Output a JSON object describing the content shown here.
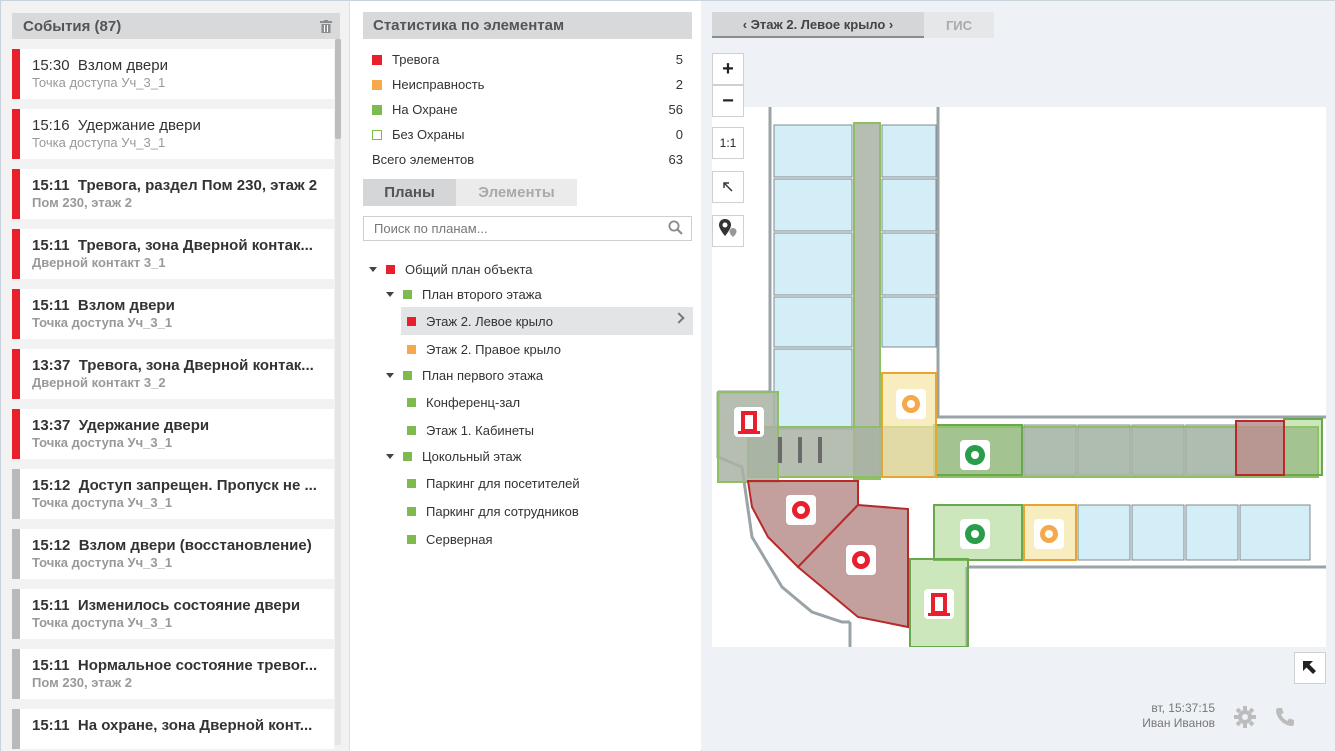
{
  "events_panel": {
    "title": "События (87)",
    "items": [
      {
        "time": "15:30",
        "title": "Взлом двери",
        "sub": "Точка доступа Уч_3_1",
        "kind": "alarm",
        "bold": false
      },
      {
        "time": "15:16",
        "title": "Удержание двери",
        "sub": "Точка доступа Уч_3_1",
        "kind": "alarm",
        "bold": false
      },
      {
        "time": "15:11",
        "title": "Тревога, раздел Пом 230, этаж 2",
        "sub": "Пом 230, этаж 2",
        "kind": "alarm",
        "bold": true
      },
      {
        "time": "15:11",
        "title": "Тревога, зона Дверной контак...",
        "sub": "Дверной контакт 3_1",
        "kind": "alarm",
        "bold": true
      },
      {
        "time": "15:11",
        "title": "Взлом двери",
        "sub": "Точка доступа Уч_3_1",
        "kind": "alarm",
        "bold": true
      },
      {
        "time": "13:37",
        "title": "Тревога, зона Дверной контак...",
        "sub": "Дверной контакт 3_2",
        "kind": "alarm",
        "bold": true
      },
      {
        "time": "13:37",
        "title": "Удержание двери",
        "sub": "Точка доступа Уч_3_1",
        "kind": "alarm",
        "bold": true
      },
      {
        "time": "15:12",
        "title": "Доступ запрещен. Пропуск не ...",
        "sub": "Точка доступа Уч_3_1",
        "kind": "normal",
        "bold": true
      },
      {
        "time": "15:12",
        "title": "Взлом двери (восстановление)",
        "sub": "Точка доступа Уч_3_1",
        "kind": "normal",
        "bold": true
      },
      {
        "time": "15:11",
        "title": "Изменилось состояние двери",
        "sub": "Точка доступа Уч_3_1",
        "kind": "normal",
        "bold": true
      },
      {
        "time": "15:11",
        "title": "Нормальное состояние тревог...",
        "sub": "Пом 230, этаж 2",
        "kind": "normal",
        "bold": true
      },
      {
        "time": "15:11",
        "title": "На охране, зона Дверной конт...",
        "sub": "",
        "kind": "normal",
        "bold": true
      }
    ]
  },
  "stats_panel": {
    "title": "Статистика по элементам",
    "rows": [
      {
        "label": "Тревога",
        "value": "5",
        "color": "#e8202e",
        "outline": false
      },
      {
        "label": "Неисправность",
        "value": "2",
        "color": "#f5a94a",
        "outline": false
      },
      {
        "label": "На Охране",
        "value": "56",
        "color": "#7dbb4f",
        "outline": false
      },
      {
        "label": "Без Охраны",
        "value": "0",
        "color": "#7dbb4f",
        "outline": true
      }
    ],
    "total_label": "Всего элементов",
    "total_value": "63"
  },
  "tabs": {
    "plans": "Планы",
    "elements": "Элементы"
  },
  "search": {
    "placeholder": "Поиск по планам..."
  },
  "tree": [
    {
      "label": "Общий план объекта",
      "level": 0,
      "expander": true,
      "color": "#e8202e",
      "selected": false
    },
    {
      "label": "План второго этажа",
      "level": 1,
      "expander": true,
      "color": "#7dbb4f",
      "selected": false
    },
    {
      "label": "Этаж 2. Левое крыло",
      "level": 2,
      "expander": false,
      "color": "#e8202e",
      "selected": true
    },
    {
      "label": "Этаж 2. Правое крыло",
      "level": 2,
      "expander": false,
      "color": "#f5a94a",
      "selected": false
    },
    {
      "label": "План первого этажа",
      "level": 1,
      "expander": true,
      "color": "#7dbb4f",
      "selected": false
    },
    {
      "label": "Конференц-зал",
      "level": 2,
      "expander": false,
      "color": "#7dbb4f",
      "selected": false
    },
    {
      "label": "Этаж 1. Кабинеты",
      "level": 2,
      "expander": false,
      "color": "#7dbb4f",
      "selected": false
    },
    {
      "label": "Цокольный этаж",
      "level": 1,
      "expander": true,
      "color": "#7dbb4f",
      "selected": false
    },
    {
      "label": "Паркинг для посетителей",
      "level": 2,
      "expander": false,
      "color": "#7dbb4f",
      "selected": false
    },
    {
      "label": "Паркинг для сотрудников",
      "level": 2,
      "expander": false,
      "color": "#7dbb4f",
      "selected": false
    },
    {
      "label": "Серверная",
      "level": 2,
      "expander": false,
      "color": "#7dbb4f",
      "selected": false
    }
  ],
  "map": {
    "active_tab": "‹ Этаж 2. Левое крыло ›",
    "gis_tab": "ГИС",
    "zoom_in": "+",
    "zoom_out": "−",
    "one_to_one": "1:1",
    "icons": {
      "select": "cursor-arrow-icon",
      "locate": "pin-marker-icon",
      "expand": "expand-arrow-icon"
    },
    "colors": {
      "alarm": "#e8202e",
      "fault": "#f5a94a",
      "armed": "#7dbb4f",
      "room": "#d3eef6"
    }
  },
  "status": {
    "datetime": "вт, 15:37:15",
    "user": "Иван Иванов"
  }
}
